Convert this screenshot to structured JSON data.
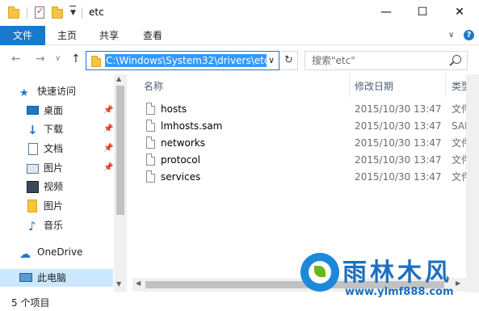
{
  "window": {
    "title": "etc",
    "minimize": "—",
    "maximize": "☐",
    "close": "✕"
  },
  "ribbon": {
    "tabs": [
      "文件",
      "主页",
      "共享",
      "查看"
    ],
    "expand": "∨",
    "help": "?"
  },
  "nav": {
    "back": "←",
    "forward": "→",
    "recent": "∨",
    "up": "↑",
    "address": "C:\\Windows\\System32\\drivers\\etc",
    "address_drop": "∨",
    "refresh": "↻",
    "search_placeholder": "搜索\"etc\""
  },
  "sidebar": {
    "items": [
      {
        "label": "快速访问",
        "icon": "star-icon",
        "pinned": false
      },
      {
        "label": "桌面",
        "icon": "desktop-icon",
        "pinned": true
      },
      {
        "label": "下载",
        "icon": "download-icon",
        "pinned": true
      },
      {
        "label": "文档",
        "icon": "document-icon",
        "pinned": true
      },
      {
        "label": "图片",
        "icon": "picture-icon",
        "pinned": true
      },
      {
        "label": "视频",
        "icon": "video-icon",
        "pinned": false
      },
      {
        "label": "图片",
        "icon": "folder-icon",
        "pinned": false
      },
      {
        "label": "音乐",
        "icon": "music-icon",
        "pinned": false
      },
      {
        "label": "OneDrive",
        "icon": "cloud-icon",
        "pinned": false
      },
      {
        "label": "此电脑",
        "icon": "computer-icon",
        "pinned": false
      }
    ]
  },
  "columns": {
    "name": "名称",
    "date": "修改日期",
    "type": "类型"
  },
  "files": [
    {
      "name": "hosts",
      "date": "2015/10/30 13:47",
      "type": "文件"
    },
    {
      "name": "lmhosts.sam",
      "date": "2015/10/30 13:47",
      "type": "SAM 文"
    },
    {
      "name": "networks",
      "date": "2015/10/30 13:47",
      "type": "文件"
    },
    {
      "name": "protocol",
      "date": "2015/10/30 13:47",
      "type": "文件"
    },
    {
      "name": "services",
      "date": "2015/10/30 13:47",
      "type": "文件"
    }
  ],
  "status": {
    "count": "5 个项目"
  },
  "watermark": {
    "title": "雨林木风",
    "url": "www.ylmf888.com"
  },
  "colors": {
    "accent": "#1979ca",
    "selection": "#3399ff",
    "sidebar_selected": "#cce8ff"
  }
}
